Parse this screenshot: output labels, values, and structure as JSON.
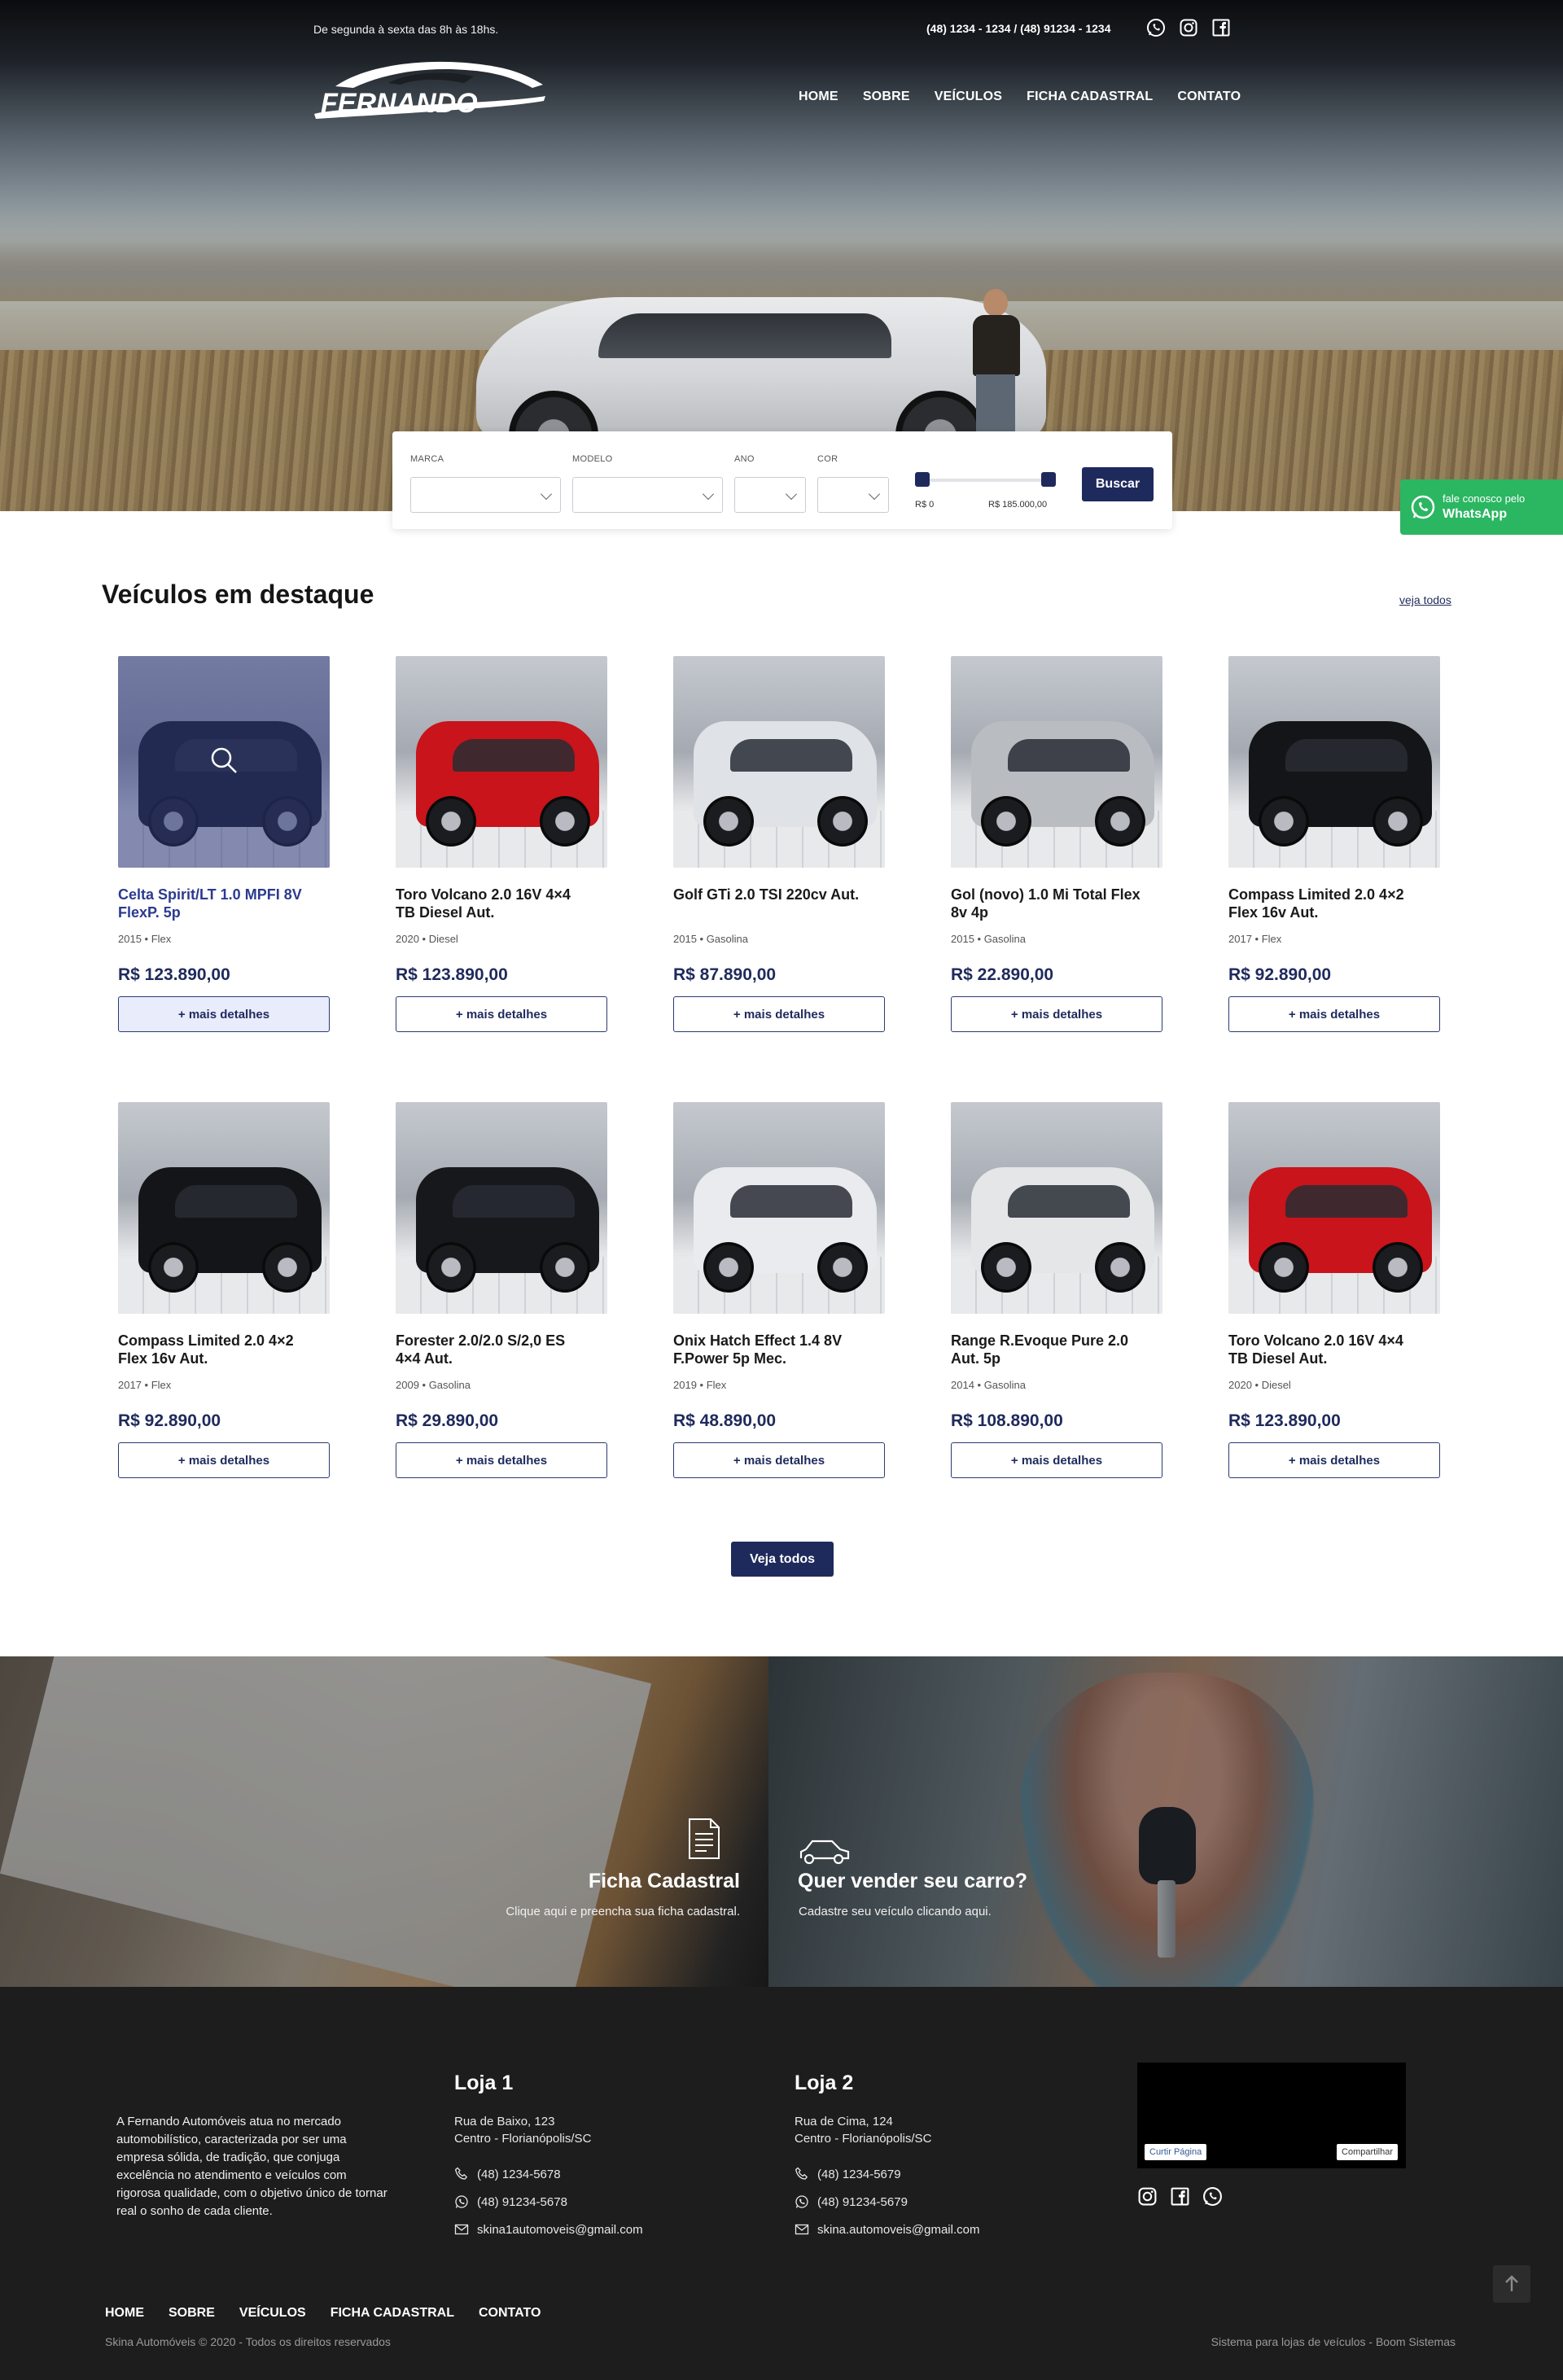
{
  "topbar": {
    "hours": "De segunda à sexta das 8h às 18hs.",
    "phones": "(48) 1234 - 1234 / (48) 91234 - 1234",
    "social_icons": [
      "whatsapp-icon",
      "instagram-icon",
      "facebook-icon"
    ]
  },
  "brand": {
    "logo_text": "FERNANDO"
  },
  "nav": {
    "items": [
      "HOME",
      "SOBRE",
      "VEÍCULOS",
      "FICHA CADASTRAL",
      "CONTATO"
    ]
  },
  "search": {
    "labels": {
      "marca": "MARCA",
      "modelo": "MODELO",
      "ano": "ANO",
      "cor": "COR"
    },
    "price_min": "R$ 0",
    "price_max": "R$ 185.000,00",
    "button": "Buscar"
  },
  "whatsapp_float": {
    "line1": "fale conosco pelo",
    "line2": "WhatsApp",
    "color": "#2bb662"
  },
  "featured": {
    "title": "Veículos em destaque",
    "see_all": "veja todos",
    "more_label": "+ mais detalhes",
    "vehicles": [
      {
        "name": "Celta Spirit/LT 1.0 MPFI 8V FlexP. 5p",
        "meta": "2015 • Flex",
        "price": "R$ 123.890,00",
        "color": "#15181c",
        "hover": true
      },
      {
        "name": "Toro Volcano 2.0 16V 4×4 TB Diesel Aut.",
        "meta": "2020 • Diesel",
        "price": "R$ 123.890,00",
        "color": "#c8141a"
      },
      {
        "name": "Golf GTi 2.0 TSI 220cv Aut.",
        "meta": "2015 • Gasolina",
        "price": "R$ 87.890,00",
        "color": "#dfe2e6"
      },
      {
        "name": "Gol (novo) 1.0 Mi Total Flex 8v 4p",
        "meta": "2015 • Gasolina",
        "price": "R$ 22.890,00",
        "color": "#b9bdc2"
      },
      {
        "name": "Compass Limited 2.0 4×2 Flex 16v Aut.",
        "meta": "2017 • Flex",
        "price": "R$ 92.890,00",
        "color": "#141518"
      },
      {
        "name": "Compass Limited 2.0 4×2 Flex 16v Aut.",
        "meta": "2017 • Flex",
        "price": "R$ 92.890,00",
        "color": "#141518"
      },
      {
        "name": "Forester 2.0/2.0 S/2,0 ES 4×4 Aut.",
        "meta": "2009 • Gasolina",
        "price": "R$ 29.890,00",
        "color": "#16181b"
      },
      {
        "name": "Onix Hatch Effect 1.4 8V F.Power 5p Mec.",
        "meta": "2019 • Flex",
        "price": "R$ 48.890,00",
        "color": "#e9ebee"
      },
      {
        "name": "Range R.Evoque Pure 2.0 Aut. 5p",
        "meta": "2014 • Gasolina",
        "price": "R$ 108.890,00",
        "color": "#e4e6e8"
      },
      {
        "name": "Toro Volcano 2.0 16V 4×4 TB Diesel Aut.",
        "meta": "2020 • Diesel",
        "price": "R$ 123.890,00",
        "color": "#c8141a"
      }
    ],
    "view_all_button": "Veja todos"
  },
  "banners": {
    "left": {
      "title": "Ficha Cadastral",
      "subtitle": "Clique aqui e preencha sua ficha cadastral.",
      "icon": "document-icon"
    },
    "right": {
      "title": "Quer vender seu carro?",
      "subtitle": "Cadastre seu veículo clicando aqui.",
      "icon": "car-icon"
    }
  },
  "footer": {
    "about": "A Fernando Automóveis atua no mercado automobilístico, caracterizada por ser uma empresa sólida, de tradição, que conjuga excelência no atendimento e veículos com rigorosa qualidade, com o objetivo único de tornar real o sonho de cada cliente.",
    "stores": [
      {
        "title": "Loja 1",
        "address1": "Rua de Baixo, 123",
        "address2": "Centro - Florianópolis/SC",
        "phone": "(48) 1234-5678",
        "whatsapp": "(48) 91234-5678",
        "email": "skina1automoveis@gmail.com"
      },
      {
        "title": "Loja 2",
        "address1": "Rua de Cima, 124",
        "address2": "Centro - Florianópolis/SC",
        "phone": "(48) 1234-5679",
        "whatsapp": "(48) 91234-5679",
        "email": "skina.automoveis@gmail.com"
      }
    ],
    "fb": {
      "like": "Curtir Página",
      "share": "Compartilhar"
    },
    "nav": [
      "HOME",
      "SOBRE",
      "VEÍCULOS",
      "FICHA CADASTRAL",
      "CONTATO"
    ],
    "copyright": "Skina Automóveis © 2020 - Todos os direitos reservados",
    "credit": "Sistema para lojas de veículos - Boom Sistemas"
  },
  "colors": {
    "primary": "#1f2a5c",
    "footer_bg": "#1d1d1d"
  }
}
